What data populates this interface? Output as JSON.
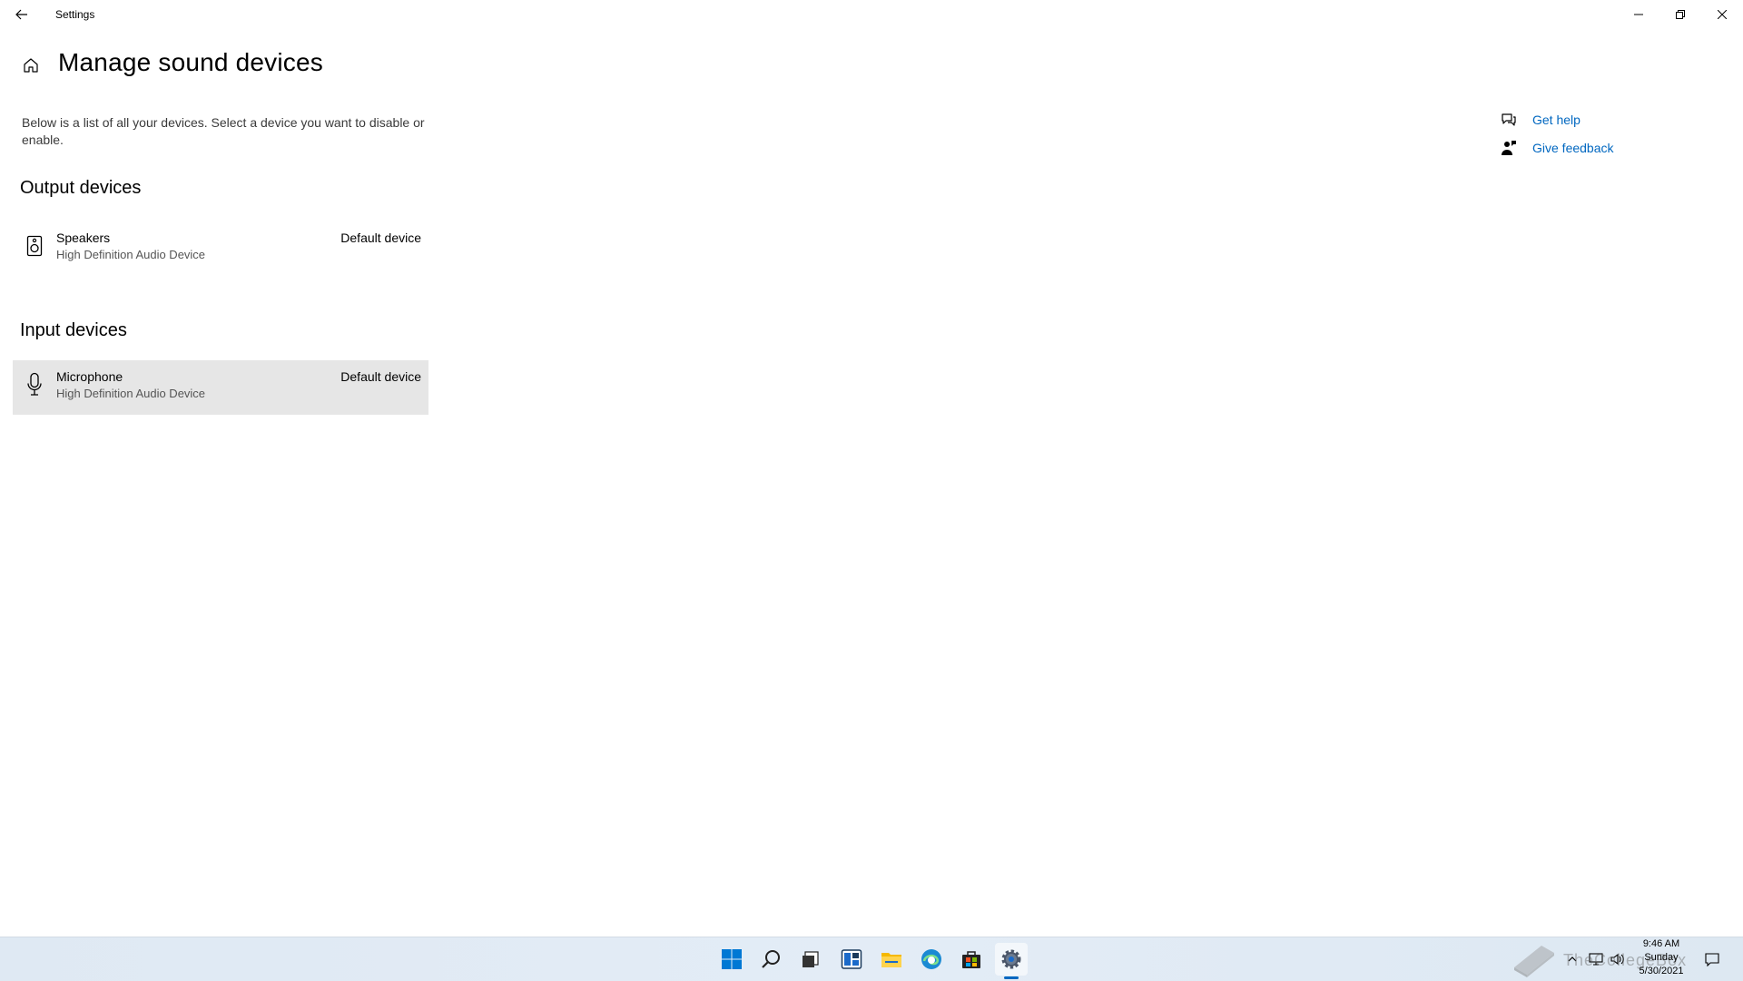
{
  "window": {
    "title": "Settings",
    "controls": {
      "minimize": "minimize",
      "maximize": "restore",
      "close": "close"
    }
  },
  "page": {
    "title": "Manage sound devices",
    "description": "Below is a list of all your devices. Select a device you want to disable or enable."
  },
  "output_section": {
    "title": "Output devices",
    "devices": [
      {
        "name": "Speakers",
        "sub": "High Definition Audio Device",
        "status": "Default device",
        "icon": "speaker-icon"
      }
    ]
  },
  "input_section": {
    "title": "Input devices",
    "devices": [
      {
        "name": "Microphone",
        "sub": "High Definition Audio Device",
        "status": "Default device",
        "icon": "microphone-icon",
        "selected": true
      }
    ]
  },
  "help": {
    "get_help": "Get help",
    "give_feedback": "Give feedback"
  },
  "taskbar": {
    "apps": [
      "start-icon",
      "search-icon",
      "task-view-icon",
      "widgets-icon",
      "file-explorer-icon",
      "edge-icon",
      "store-icon",
      "settings-icon"
    ],
    "active_app": "settings-icon",
    "clock": {
      "time": "9:46 AM",
      "day": "Sunday",
      "date": "5/30/2021"
    },
    "watermark": "TheCollegeBox"
  },
  "colors": {
    "link": "#0067c0",
    "selected_row": "#e6e6e6",
    "taskbar": "#e1eaf4"
  }
}
